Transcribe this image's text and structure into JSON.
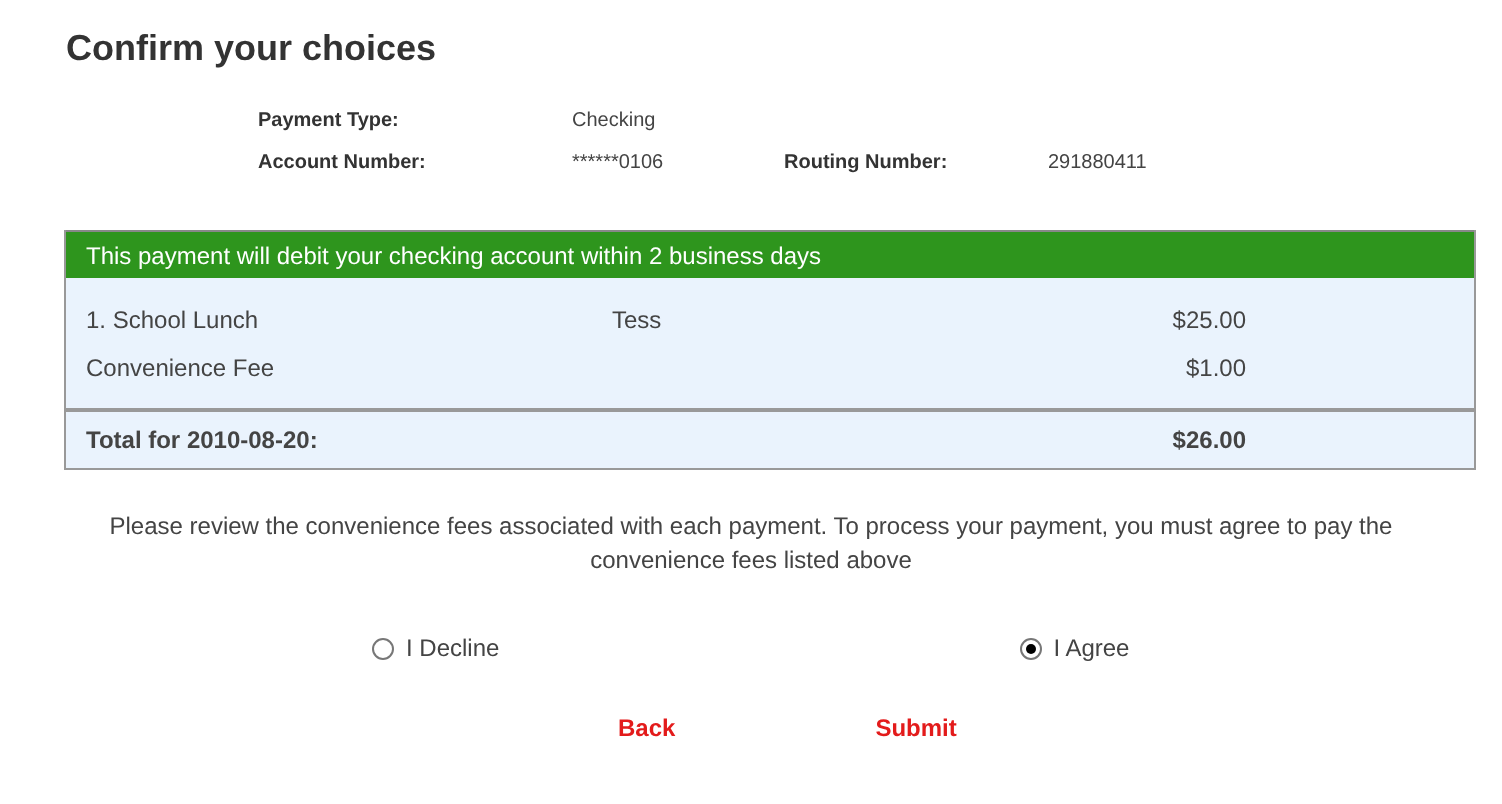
{
  "title": "Confirm your choices",
  "details": [
    {
      "label": "Payment Type:",
      "value": "Checking"
    },
    {
      "label": "Account Number:",
      "value": "******0106",
      "extra_label": "Routing Number:",
      "extra_value": "291880411"
    }
  ],
  "table": {
    "header": "This payment will debit your checking account within 2 business days",
    "rows": [
      {
        "item": "1. School Lunch",
        "student": "Tess",
        "amount": "$25.00"
      },
      {
        "item": "Convenience Fee",
        "amount": "$1.00"
      }
    ],
    "total": {
      "label": "Total for 2010-08-20:",
      "amount": "$26.00"
    }
  },
  "note": "Please review the convenience fees associated with each payment. To process your payment, you must agree to pay the convenience fees listed above",
  "choices": [
    {
      "label": "I Decline",
      "selected": false
    },
    {
      "label": "I Agree",
      "selected": true
    }
  ],
  "buttons": [
    "Back",
    "Submit"
  ]
}
